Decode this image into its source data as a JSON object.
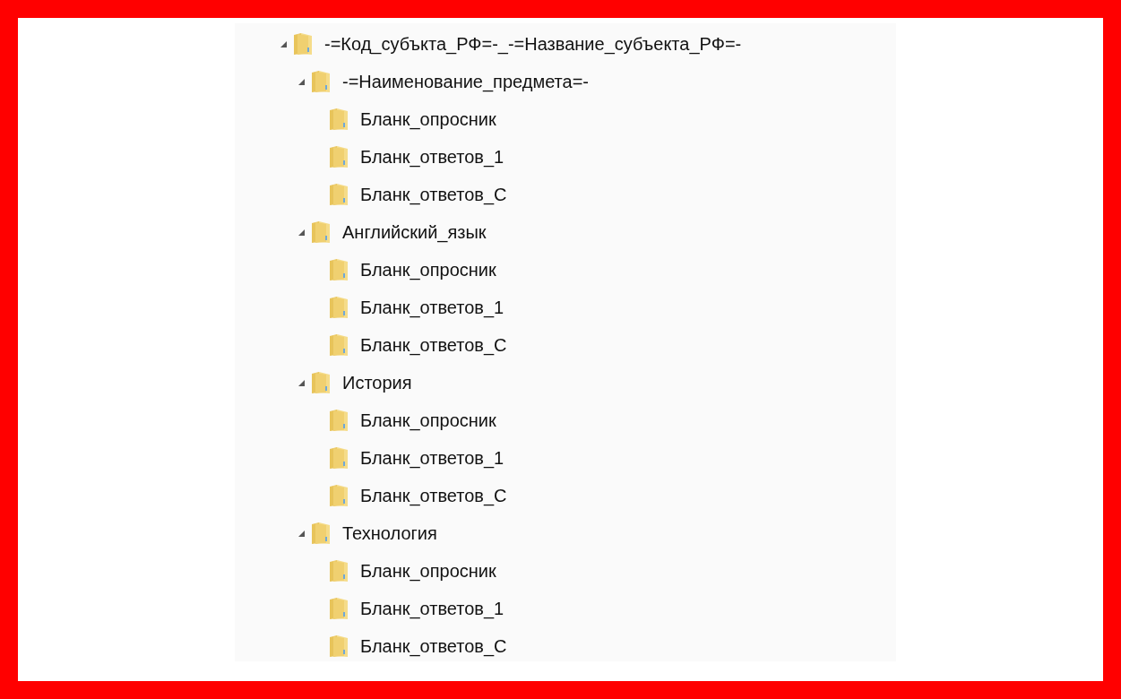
{
  "tree": [
    {
      "label": "-=Код_субъкта_РФ=-_-=Название_субъекта_РФ=-",
      "expanded": true,
      "children": [
        {
          "label": "-=Наименование_предмета=-",
          "expanded": true,
          "children": [
            {
              "label": "Бланк_опросник"
            },
            {
              "label": "Бланк_ответов_1"
            },
            {
              "label": "Бланк_ответов_С"
            }
          ]
        },
        {
          "label": "Английский_язык",
          "expanded": true,
          "children": [
            {
              "label": "Бланк_опросник"
            },
            {
              "label": "Бланк_ответов_1"
            },
            {
              "label": "Бланк_ответов_С"
            }
          ]
        },
        {
          "label": "История",
          "expanded": true,
          "children": [
            {
              "label": "Бланк_опросник"
            },
            {
              "label": "Бланк_ответов_1"
            },
            {
              "label": "Бланк_ответов_С"
            }
          ]
        },
        {
          "label": "Технология",
          "expanded": true,
          "children": [
            {
              "label": "Бланк_опросник"
            },
            {
              "label": "Бланк_ответов_1"
            },
            {
              "label": "Бланк_ответов_С"
            }
          ]
        }
      ]
    }
  ]
}
